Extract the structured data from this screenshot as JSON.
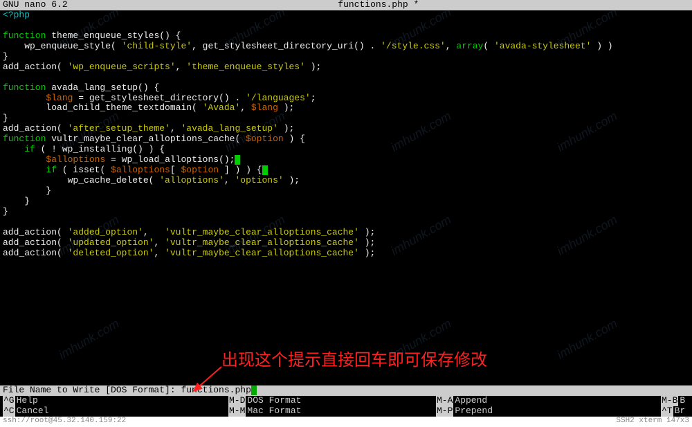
{
  "title": {
    "left": "GNU nano 6.2",
    "center": "functions.php *"
  },
  "code": [
    {
      "tokens": [
        {
          "t": "<?php",
          "c": "cyan"
        }
      ]
    },
    {
      "tokens": []
    },
    {
      "tokens": [
        {
          "t": "function",
          "c": "green"
        },
        {
          "t": " theme_enqueue_styles() {",
          "c": "white"
        }
      ]
    },
    {
      "tokens": [
        {
          "t": "    wp_enqueue_style( ",
          "c": "white"
        },
        {
          "t": "'child-style'",
          "c": "yellow"
        },
        {
          "t": ", get_stylesheet_directory_uri() . ",
          "c": "white"
        },
        {
          "t": "'/style.css'",
          "c": "yellow"
        },
        {
          "t": ", ",
          "c": "white"
        },
        {
          "t": "array",
          "c": "green"
        },
        {
          "t": "( ",
          "c": "white"
        },
        {
          "t": "'avada-stylesheet'",
          "c": "yellow"
        },
        {
          "t": " ) )",
          "c": "white"
        }
      ]
    },
    {
      "tokens": [
        {
          "t": "}",
          "c": "white"
        }
      ]
    },
    {
      "tokens": [
        {
          "t": "add_action( ",
          "c": "white"
        },
        {
          "t": "'wp_enqueue_scripts'",
          "c": "yellow"
        },
        {
          "t": ", ",
          "c": "white"
        },
        {
          "t": "'theme_enqueue_styles'",
          "c": "yellow"
        },
        {
          "t": " );",
          "c": "white"
        }
      ]
    },
    {
      "tokens": []
    },
    {
      "tokens": [
        {
          "t": "function",
          "c": "green"
        },
        {
          "t": " avada_lang_setup() {",
          "c": "white"
        }
      ]
    },
    {
      "tokens": [
        {
          "t": "        ",
          "c": "white"
        },
        {
          "t": "$lang",
          "c": "orange"
        },
        {
          "t": " = get_stylesheet_directory() . ",
          "c": "white"
        },
        {
          "t": "'/languages'",
          "c": "yellow"
        },
        {
          "t": ";",
          "c": "white"
        }
      ]
    },
    {
      "tokens": [
        {
          "t": "        load_child_theme_textdomain( ",
          "c": "white"
        },
        {
          "t": "'Avada'",
          "c": "yellow"
        },
        {
          "t": ", ",
          "c": "white"
        },
        {
          "t": "$lang",
          "c": "orange"
        },
        {
          "t": " );",
          "c": "white"
        }
      ]
    },
    {
      "tokens": [
        {
          "t": "}",
          "c": "white"
        }
      ]
    },
    {
      "tokens": [
        {
          "t": "add_action( ",
          "c": "white"
        },
        {
          "t": "'after_setup_theme'",
          "c": "yellow"
        },
        {
          "t": ", ",
          "c": "white"
        },
        {
          "t": "'avada_lang_setup'",
          "c": "yellow"
        },
        {
          "t": " );",
          "c": "white"
        }
      ]
    },
    {
      "tokens": [
        {
          "t": "function",
          "c": "green"
        },
        {
          "t": " vultr_maybe_clear_alloptions_cache( ",
          "c": "white"
        },
        {
          "t": "$option",
          "c": "orange"
        },
        {
          "t": " ) {",
          "c": "white"
        }
      ]
    },
    {
      "tokens": [
        {
          "t": "    ",
          "c": "white"
        },
        {
          "t": "if",
          "c": "green"
        },
        {
          "t": " ( ! wp_installing() ) {",
          "c": "white"
        }
      ]
    },
    {
      "tokens": [
        {
          "t": "        ",
          "c": "white"
        },
        {
          "t": "$alloptions",
          "c": "orange"
        },
        {
          "t": " = wp_load_alloptions();",
          "c": "white"
        },
        {
          "t": "",
          "c": "cursor"
        }
      ]
    },
    {
      "tokens": [
        {
          "t": "        ",
          "c": "white"
        },
        {
          "t": "if",
          "c": "green"
        },
        {
          "t": " ( isset( ",
          "c": "white"
        },
        {
          "t": "$alloptions",
          "c": "orange"
        },
        {
          "t": "[ ",
          "c": "white"
        },
        {
          "t": "$option",
          "c": "orange"
        },
        {
          "t": " ] ) ) {",
          "c": "white"
        },
        {
          "t": "",
          "c": "cursor"
        }
      ]
    },
    {
      "tokens": [
        {
          "t": "            wp_cache_delete( ",
          "c": "white"
        },
        {
          "t": "'alloptions'",
          "c": "yellow"
        },
        {
          "t": ", ",
          "c": "white"
        },
        {
          "t": "'options'",
          "c": "yellow"
        },
        {
          "t": " );",
          "c": "white"
        }
      ]
    },
    {
      "tokens": [
        {
          "t": "        }",
          "c": "white"
        }
      ]
    },
    {
      "tokens": [
        {
          "t": "    }",
          "c": "white"
        }
      ]
    },
    {
      "tokens": [
        {
          "t": "}",
          "c": "white"
        }
      ]
    },
    {
      "tokens": []
    },
    {
      "tokens": [
        {
          "t": "add_action( ",
          "c": "white"
        },
        {
          "t": "'added_option'",
          "c": "yellow"
        },
        {
          "t": ",   ",
          "c": "white"
        },
        {
          "t": "'vultr_maybe_clear_alloptions_cache'",
          "c": "yellow"
        },
        {
          "t": " );",
          "c": "white"
        }
      ]
    },
    {
      "tokens": [
        {
          "t": "add_action( ",
          "c": "white"
        },
        {
          "t": "'updated_option'",
          "c": "yellow"
        },
        {
          "t": ", ",
          "c": "white"
        },
        {
          "t": "'vultr_maybe_clear_alloptions_cache'",
          "c": "yellow"
        },
        {
          "t": " );",
          "c": "white"
        }
      ]
    },
    {
      "tokens": [
        {
          "t": "add_action( ",
          "c": "white"
        },
        {
          "t": "'deleted_option'",
          "c": "yellow"
        },
        {
          "t": ", ",
          "c": "white"
        },
        {
          "t": "'vultr_maybe_clear_alloptions_cache'",
          "c": "yellow"
        },
        {
          "t": " );",
          "c": "white"
        }
      ]
    }
  ],
  "prompt": {
    "label": "File Name to Write [DOS Format]: ",
    "value": "functions.php"
  },
  "help": [
    [
      {
        "key": "^G",
        "label": "Help"
      },
      {
        "key": "M-D",
        "label": "DOS Format"
      },
      {
        "key": "M-A",
        "label": "Append"
      },
      {
        "key": "M-B",
        "label": "B"
      }
    ],
    [
      {
        "key": "^C",
        "label": "Cancel"
      },
      {
        "key": "M-M",
        "label": "Mac Format"
      },
      {
        "key": "M-P",
        "label": "Prepend"
      },
      {
        "key": "^T",
        "label": "Br"
      }
    ]
  ],
  "status": {
    "left": "ssh://root@45.32.140.159:22",
    "right_items": [
      "SSH2",
      "xterm",
      "147x3"
    ]
  },
  "annotation": "出现这个提示直接回车即可保存修改",
  "watermark": "imhunk.com"
}
